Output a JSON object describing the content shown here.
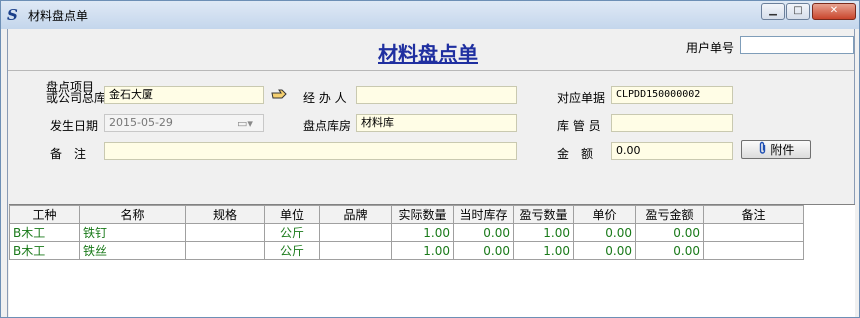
{
  "window": {
    "title": "材料盘点单",
    "min_glyph": "▁",
    "max_glyph": "□",
    "close_glyph": "✕"
  },
  "header": {
    "title": "材料盘点单",
    "user_no_label": "用户单号",
    "user_no_value": ""
  },
  "form": {
    "project_label_line1": "盘点项目",
    "project_label_line2": "或公司总库",
    "project_value": "金石大厦",
    "handler_label": "经 办 人",
    "handler_value": "",
    "ref_no_label": "对应单据",
    "ref_no_value": "CLPDD150000002",
    "date_label": "发生日期",
    "date_value": "2015-05-29",
    "warehouse_label": "盘点库房",
    "warehouse_value": "材料库",
    "keeper_label": "库 管 员",
    "keeper_value": "",
    "note_label": "备　注",
    "note_value": "",
    "amount_label": "金　额",
    "amount_value": "0.00",
    "attach_label": "附件",
    "attach_icon": "paperclip-icon",
    "hand_icon": "pointing-hand-icon",
    "calendar_icon": "calendar-icon"
  },
  "table": {
    "columns": [
      "工种",
      "名称",
      "规格",
      "单位",
      "品牌",
      "实际数量",
      "当时库存",
      "盈亏数量",
      "单价",
      "盈亏金额",
      "备注"
    ],
    "rows": [
      [
        "B木工",
        "铁钉",
        "",
        "公斤",
        "",
        "1.00",
        "0.00",
        "1.00",
        "0.00",
        "0.00",
        ""
      ],
      [
        "B木工",
        "铁丝",
        "",
        "公斤",
        "",
        "1.00",
        "0.00",
        "1.00",
        "0.00",
        "0.00",
        ""
      ]
    ]
  },
  "colors": {
    "title_blue": "#1f2fa0",
    "row_text_green": "#1a7a1a",
    "input_yellow": "#fffde6"
  }
}
